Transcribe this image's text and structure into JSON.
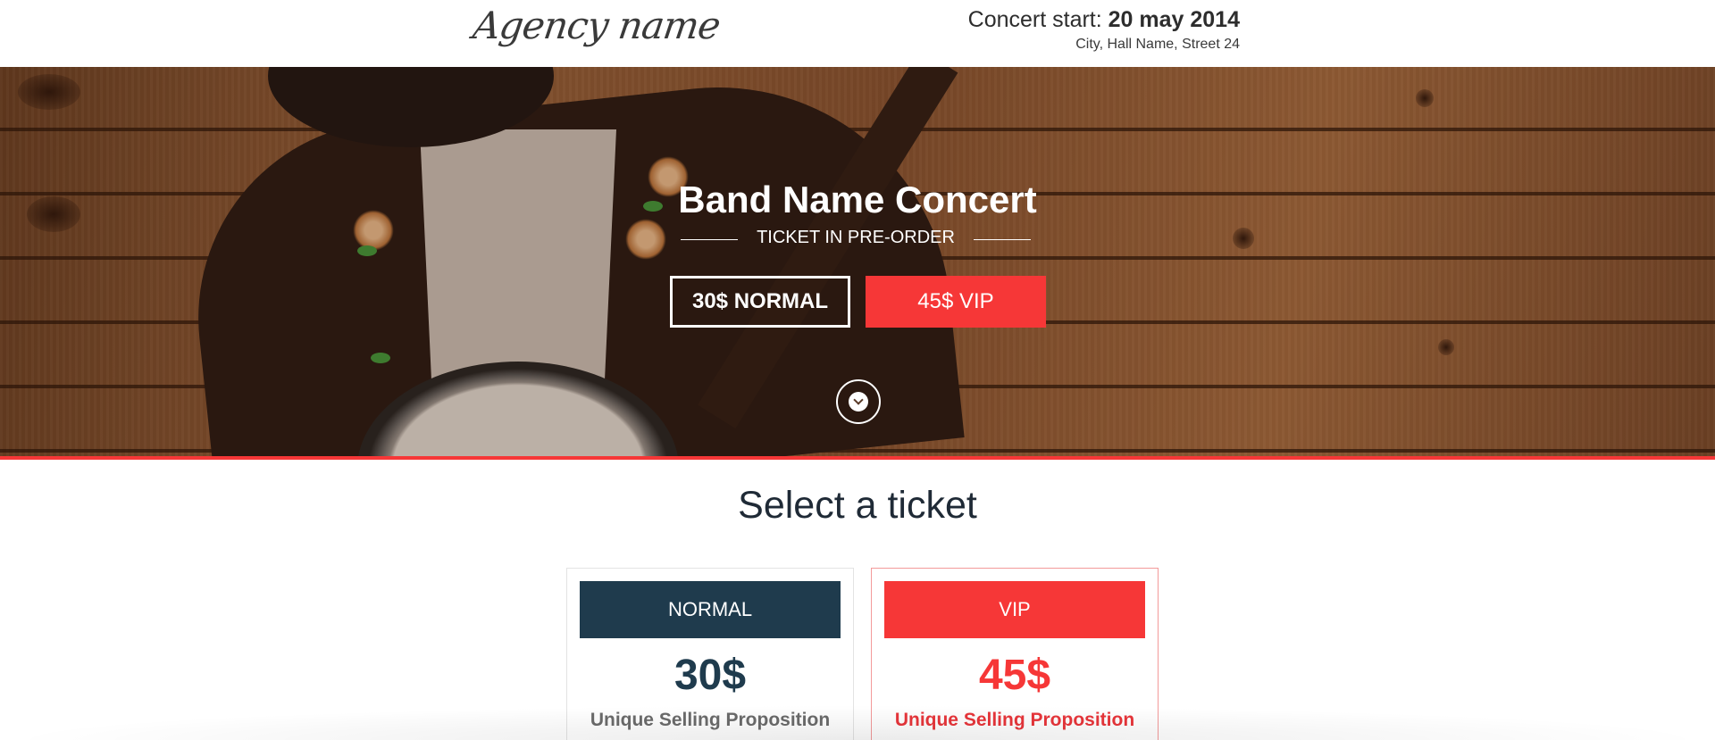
{
  "header": {
    "logo_text": "Agency name",
    "concert_start_label": "Concert start: ",
    "concert_date": "20 may 2014",
    "venue": "City, Hall Name, Street 24"
  },
  "hero": {
    "title": "Band Name Concert",
    "subtitle": "TICKET IN PRE-ORDER",
    "normal_button": "30$ NORMAL",
    "vip_button": "45$ VIP",
    "scroll_icon": "chevron-down-icon"
  },
  "tickets": {
    "section_title": "Select a ticket",
    "cards": [
      {
        "name": "NORMAL",
        "price": "30$",
        "usp": "Unique Selling Proposition"
      },
      {
        "name": "VIP",
        "price": "45$",
        "usp": "Unique Selling Proposition"
      }
    ]
  },
  "colors": {
    "accent_red": "#f63737",
    "dark_navy": "#1f3b4d",
    "text_dark": "#1f2a36"
  }
}
